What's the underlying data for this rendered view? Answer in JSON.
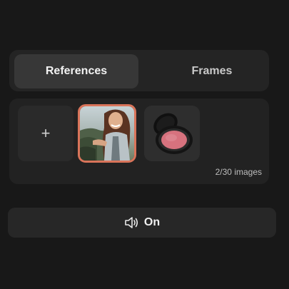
{
  "tabs": [
    {
      "label": "References",
      "active": true
    },
    {
      "label": "Frames",
      "active": false
    }
  ],
  "references": {
    "add_label": "+",
    "items": [
      {
        "icon": "portrait-photo",
        "selected": true
      },
      {
        "icon": "blush-compact",
        "selected": false
      }
    ],
    "count_text": "2/30 images"
  },
  "sound": {
    "icon": "speaker-icon",
    "label": "On"
  },
  "colors": {
    "background": "#181818",
    "panel": "#242424",
    "active_tab": "#373737",
    "selection_border": "#d9745a"
  }
}
